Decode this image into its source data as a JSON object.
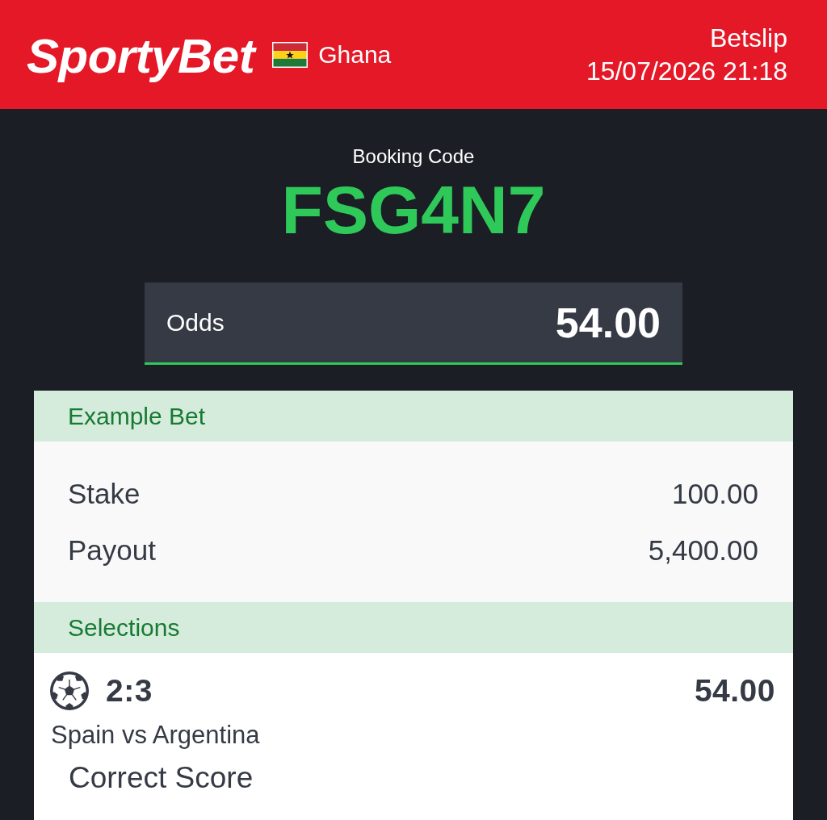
{
  "header": {
    "logo": "SportyBet",
    "country": "Ghana",
    "title": "Betslip",
    "datetime": "15/07/2026 21:18"
  },
  "booking": {
    "label": "Booking Code",
    "code": "FSG4N7"
  },
  "odds": {
    "label": "Odds",
    "value": "54.00"
  },
  "example_bet": {
    "title": "Example Bet",
    "rows": [
      {
        "label": "Stake",
        "value": "100.00"
      },
      {
        "label": "Payout",
        "value": "5,400.00"
      }
    ]
  },
  "selections": {
    "title": "Selections",
    "items": [
      {
        "pick": "2:3",
        "odds": "54.00",
        "match": "Spain vs Argentina",
        "market": "Correct Score"
      }
    ]
  }
}
